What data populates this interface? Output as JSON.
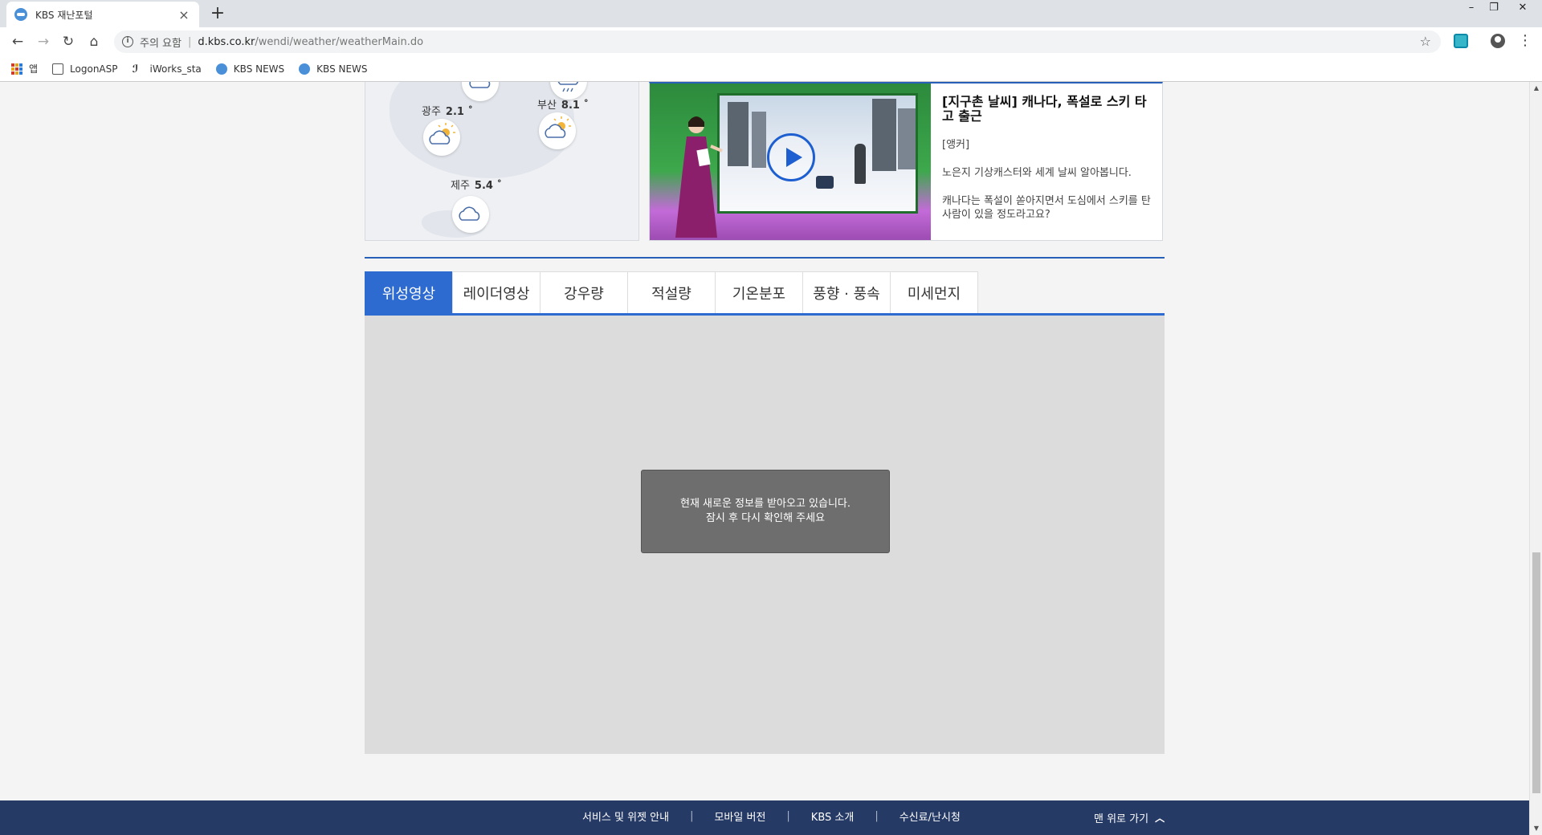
{
  "browser": {
    "tab_title": "KBS 재난포털",
    "tab_close": "×",
    "new_tab": "+",
    "window_controls": {
      "minimize": "–",
      "restore": "❐",
      "close": "✕"
    },
    "nav": {
      "back": "←",
      "forward": "→",
      "reload": "↻",
      "home": "⌂"
    },
    "url": {
      "security_label": "주의 요함",
      "host": "d.kbs.co.kr",
      "path": "/wendi/weather/weatherMain.do"
    },
    "bookmarks": [
      {
        "label": "앱",
        "icon": "apps-grid-icon"
      },
      {
        "label": "LogonASP",
        "icon": "page-icon"
      },
      {
        "label": "iWorks_sta",
        "icon": "iworks-logo-icon"
      },
      {
        "label": "KBS NEWS",
        "icon": "kbs-icon"
      },
      {
        "label": "KBS NEWS",
        "icon": "kbs-icon"
      }
    ]
  },
  "map": {
    "cities": [
      {
        "name": "광주",
        "temp": "2.1 ˚",
        "icon": "partly-cloudy-icon"
      },
      {
        "name": "부산",
        "temp": "8.1 ˚",
        "icon": "partly-cloudy-icon"
      },
      {
        "name": "제주",
        "temp": "5.4 ˚",
        "icon": "cloudy-icon"
      }
    ]
  },
  "news": {
    "title": "[지구촌 날씨] 캐나다, 폭설로 스키 타고 출근",
    "paragraphs": [
      "[앵커]",
      "노은지 기상캐스터와 세계 날씨 알아봅니다.",
      "캐나다는 폭설이 쏟아지면서 도심에서 스키를 탄 사람이 있을 정도라고요?"
    ]
  },
  "weather_tabs": {
    "active_index": 0,
    "items": [
      "위성영상",
      "레이더영상",
      "강우량",
      "적설량",
      "기온분포",
      "풍향 · 풍속",
      "미세먼지"
    ]
  },
  "loading": {
    "line1": "현재 새로운 정보를 받아오고 있습니다.",
    "line2": "잠시 후 다시 확인해 주세요"
  },
  "footer": {
    "links": [
      "서비스 및 위젯 안내",
      "모바일 버전",
      "KBS 소개",
      "수신료/난시청"
    ],
    "separator": "|",
    "to_top": "맨 위로 가기",
    "to_top_icon": "chevron-up-icon"
  },
  "colors": {
    "accent": "#2e6bd0",
    "footer": "#263a66",
    "panel": "#dcdcdc",
    "loading_box": "#6e6e6e"
  }
}
